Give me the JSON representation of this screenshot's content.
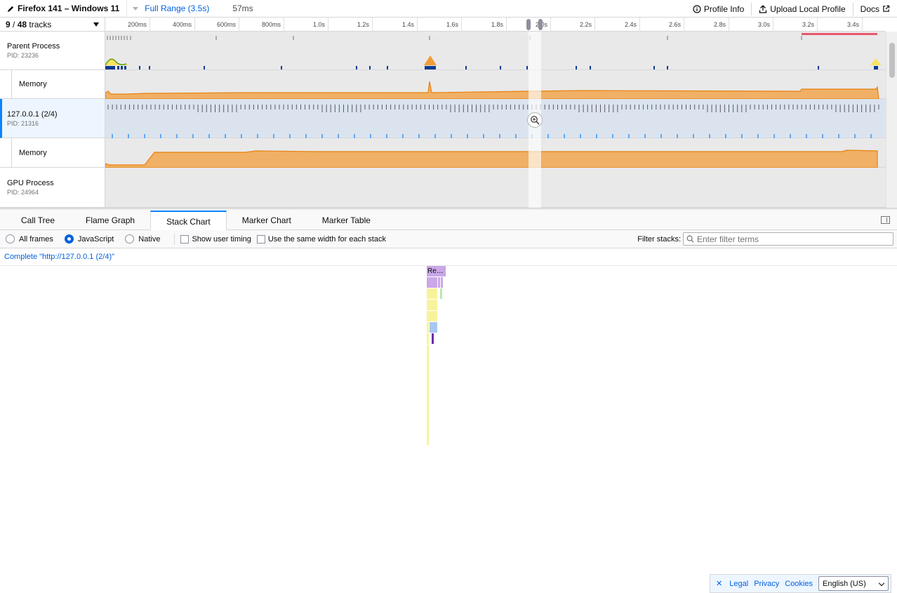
{
  "topbar": {
    "title": "Firefox 141 – Windows 11",
    "full_range": "Full Range (3.5s)",
    "uncommitted": "57ms",
    "profile_info": "Profile Info",
    "upload": "Upload Local Profile",
    "docs": "Docs"
  },
  "timeline": {
    "tracks_count_visible": "9",
    "tracks_count_sep": " / ",
    "tracks_count_total": "48",
    "tracks_word": " tracks",
    "ticks": [
      "200ms",
      "400ms",
      "600ms",
      "800ms",
      "1.0s",
      "1.2s",
      "1.4s",
      "1.6s",
      "1.8s",
      "2.0s",
      "2.2s",
      "2.4s",
      "2.6s",
      "2.8s",
      "3.0s",
      "3.2s",
      "3.4s"
    ],
    "tracks": [
      {
        "name": "Parent Process",
        "pid": "PID: 23236"
      },
      {
        "name": "Memory"
      },
      {
        "name": "127.0.0.1 (2/4)",
        "pid": "PID: 21316"
      },
      {
        "name": "Memory"
      },
      {
        "name": "GPU Process",
        "pid": "PID: 24964"
      }
    ],
    "memory_color": "#f29c38",
    "selection_color": "#0a84ff"
  },
  "tabs": [
    "Call Tree",
    "Flame Graph",
    "Stack Chart",
    "Marker Chart",
    "Marker Table"
  ],
  "active_tab": "Stack Chart",
  "settings": {
    "radios": [
      "All frames",
      "JavaScript",
      "Native"
    ],
    "selected_radio": "JavaScript",
    "show_user_timing": "Show user timing",
    "same_width": "Use the same width for each stack",
    "filter_label": "Filter stacks:",
    "filter_placeholder": "Enter filter terms"
  },
  "breadcrumb": "Complete \"http://127.0.0.1 (2/4)\"",
  "stack_chart": {
    "top_frame_label": "Re…",
    "colors": {
      "purple": "#c9a7e8",
      "yellow": "#f8f39b",
      "blue": "#a6c7f2",
      "green": "#b7e8b0",
      "dark_purple": "#6b2ca8"
    }
  },
  "footer": {
    "links": [
      "Legal",
      "Privacy",
      "Cookies"
    ],
    "language": "English (US)"
  }
}
